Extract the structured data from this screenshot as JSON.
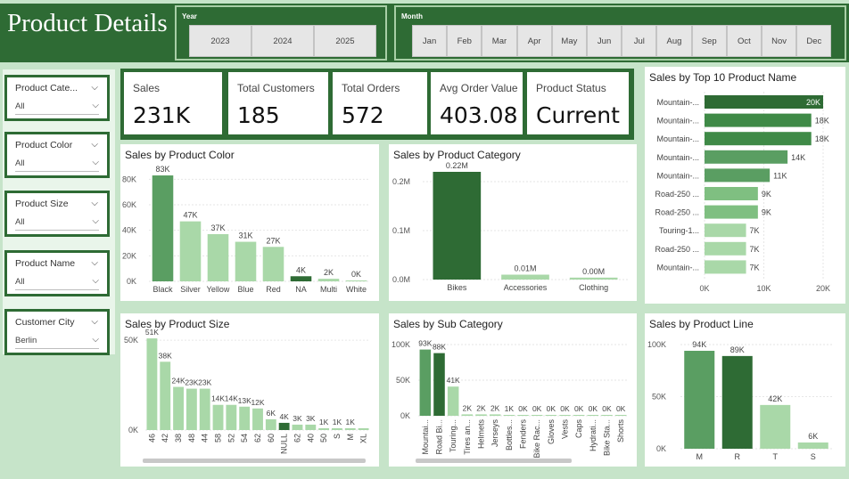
{
  "title": "Product Details",
  "year_slicer": {
    "label": "Year",
    "options": [
      "2023",
      "2024",
      "2025"
    ]
  },
  "month_slicer": {
    "label": "Month",
    "options": [
      "Jan",
      "Feb",
      "Mar",
      "Apr",
      "May",
      "Jun",
      "Jul",
      "Aug",
      "Sep",
      "Oct",
      "Nov",
      "Dec"
    ]
  },
  "filters": [
    {
      "label": "Product Cate...",
      "value": "All"
    },
    {
      "label": "Product Color",
      "value": "All"
    },
    {
      "label": "Product Size",
      "value": "All"
    },
    {
      "label": "Product Name",
      "value": "All"
    },
    {
      "label": "Customer City",
      "value": "Berlin"
    }
  ],
  "kpis": [
    {
      "label": "Sales",
      "value": "231K"
    },
    {
      "label": "Total Customers",
      "value": "185"
    },
    {
      "label": "Total Orders",
      "value": "572"
    },
    {
      "label": "Avg Order Value",
      "value": "403.08"
    },
    {
      "label": "Product Status",
      "value": "Current"
    }
  ],
  "colors": {
    "dark": "#2e6b34",
    "mid": "#5a9e62",
    "light": "#a9d8a8",
    "bg": "#c6e4c9"
  },
  "chart_data": [
    {
      "id": "color",
      "type": "bar",
      "title": "Sales by Product Color",
      "categories": [
        "Black",
        "Silver",
        "Yellow",
        "Blue",
        "Red",
        "NA",
        "Multi",
        "White"
      ],
      "values": [
        83,
        47,
        37,
        31,
        27,
        4,
        2,
        0.3
      ],
      "labels": [
        "83K",
        "47K",
        "37K",
        "31K",
        "27K",
        "4K",
        "2K",
        "0K"
      ],
      "yticks": [
        "0K",
        "20K",
        "40K",
        "60K",
        "80K"
      ],
      "ylim": [
        0,
        90
      ]
    },
    {
      "id": "category",
      "type": "bar",
      "title": "Sales by Product Category",
      "categories": [
        "Bikes",
        "Accessories",
        "Clothing"
      ],
      "values": [
        0.22,
        0.01,
        0.004
      ],
      "labels": [
        "0.22M",
        "0.01M",
        "0.00M"
      ],
      "yticks": [
        "0.0M",
        "0.1M",
        "0.2M"
      ],
      "ylim": [
        0,
        0.24
      ]
    },
    {
      "id": "top10",
      "type": "bar",
      "title": "Sales by Top 10 Product Name",
      "categories": [
        "Mountain-...",
        "Mountain-...",
        "Mountain-...",
        "Mountain-...",
        "Mountain-...",
        "Road-250 ...",
        "Road-250 ...",
        "Touring-1...",
        "Road-250 ...",
        "Mountain-..."
      ],
      "values": [
        20,
        18,
        18,
        14,
        11,
        9,
        9,
        7,
        7,
        7
      ],
      "labels": [
        "20K",
        "18K",
        "18K",
        "14K",
        "11K",
        "9K",
        "9K",
        "7K",
        "7K",
        "7K"
      ],
      "xticks": [
        "0K",
        "10K",
        "20K"
      ],
      "xlim": [
        0,
        20
      ]
    },
    {
      "id": "size",
      "type": "bar",
      "title": "Sales by Product Size",
      "categories": [
        "46",
        "42",
        "38",
        "48",
        "44",
        "58",
        "52",
        "54",
        "62",
        "60",
        "NULL",
        "62",
        "40",
        "50",
        "S",
        "M",
        "XL"
      ],
      "values": [
        51,
        38,
        24,
        23,
        23,
        14,
        14,
        13,
        12,
        6,
        4,
        3,
        3,
        1,
        1,
        1,
        1
      ],
      "labels": [
        "51K",
        "38K",
        "24K",
        "23K",
        "23K",
        "14K",
        "14K",
        "13K",
        "12K",
        "6K",
        "4K",
        "3K",
        "3K",
        "1K",
        "1K",
        "1K",
        ""
      ],
      "yticks": [
        "0K",
        "50K"
      ],
      "ylim": [
        0,
        55
      ]
    },
    {
      "id": "subcat",
      "type": "bar",
      "title": "Sales by Sub Category",
      "categories": [
        "Mountai...",
        "Road Bi...",
        "Touring...",
        "Tires an...",
        "Helmets",
        "Jerseys",
        "Bottles...",
        "Fenders",
        "Bike Rac...",
        "Gloves",
        "Vests",
        "Caps",
        "Hydrati...",
        "Bike Sta...",
        "Shorts"
      ],
      "values": [
        93,
        88,
        41,
        2,
        2,
        2,
        1,
        0.3,
        0.3,
        0.3,
        0.3,
        0.3,
        0.3,
        0.3,
        0.3
      ],
      "labels": [
        "93K",
        "88K",
        "41K",
        "2K",
        "2K",
        "2K",
        "1K",
        "0K",
        "0K",
        "0K",
        "0K",
        "0K",
        "0K",
        "0K",
        "0K"
      ],
      "yticks": [
        "0K",
        "50K",
        "100K"
      ],
      "ylim": [
        0,
        100
      ]
    },
    {
      "id": "line",
      "type": "bar",
      "title": "Sales by Product Line",
      "categories": [
        "M",
        "R",
        "T",
        "S"
      ],
      "values": [
        94,
        89,
        42,
        6
      ],
      "labels": [
        "94K",
        "89K",
        "42K",
        "6K"
      ],
      "yticks": [
        "0K",
        "50K",
        "100K"
      ],
      "ylim": [
        0,
        100
      ]
    }
  ]
}
